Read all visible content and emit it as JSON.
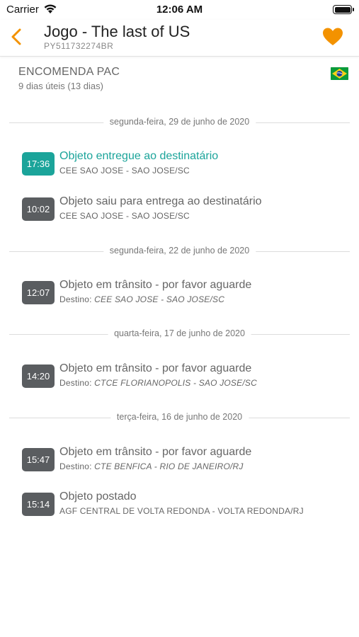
{
  "status_bar": {
    "carrier": "Carrier",
    "time": "12:06 AM",
    "battery_level": 1.0
  },
  "header": {
    "title": "Jogo - The last of US",
    "tracking_code": "PY511732274BR",
    "back_icon": "chevron-left-icon",
    "favorite_icon": "heart-icon",
    "accent_color": "#f39200"
  },
  "package": {
    "service": "ENCOMENDA PAC",
    "deadline": "9 dias úteis (13 dias)",
    "flag_icon": "brazil-flag-icon"
  },
  "colors": {
    "delivered": "#1ba49a",
    "badge": "#5a5d60"
  },
  "timeline": [
    {
      "date": "segunda-feira, 29 de junho de 2020",
      "events": [
        {
          "time": "17:36",
          "title": "Objeto entregue ao destinatário",
          "location": "CEE SAO JOSE - SAO JOSE/SC",
          "delivered": true
        },
        {
          "time": "10:02",
          "title": "Objeto saiu para entrega ao destinatário",
          "location": "CEE SAO JOSE - SAO JOSE/SC"
        }
      ]
    },
    {
      "date": "segunda-feira, 22 de junho de 2020",
      "events": [
        {
          "time": "12:07",
          "title": "Objeto em trânsito - por favor aguarde",
          "dest_label": "Destino:",
          "destination": "CEE SAO JOSE - SAO JOSE/SC"
        }
      ]
    },
    {
      "date": "quarta-feira, 17 de junho de 2020",
      "events": [
        {
          "time": "14:20",
          "title": "Objeto em trânsito - por favor aguarde",
          "dest_label": "Destino:",
          "destination": "CTCE FLORIANOPOLIS - SAO JOSE/SC"
        }
      ]
    },
    {
      "date": "terça-feira, 16 de junho de 2020",
      "events": [
        {
          "time": "15:47",
          "title": "Objeto em trânsito - por favor aguarde",
          "dest_label": "Destino:",
          "destination": "CTE BENFICA - RIO DE JANEIRO/RJ"
        },
        {
          "time": "15:14",
          "title": "Objeto postado",
          "location": "AGF CENTRAL DE VOLTA REDONDA - VOLTA REDONDA/RJ"
        }
      ]
    }
  ]
}
